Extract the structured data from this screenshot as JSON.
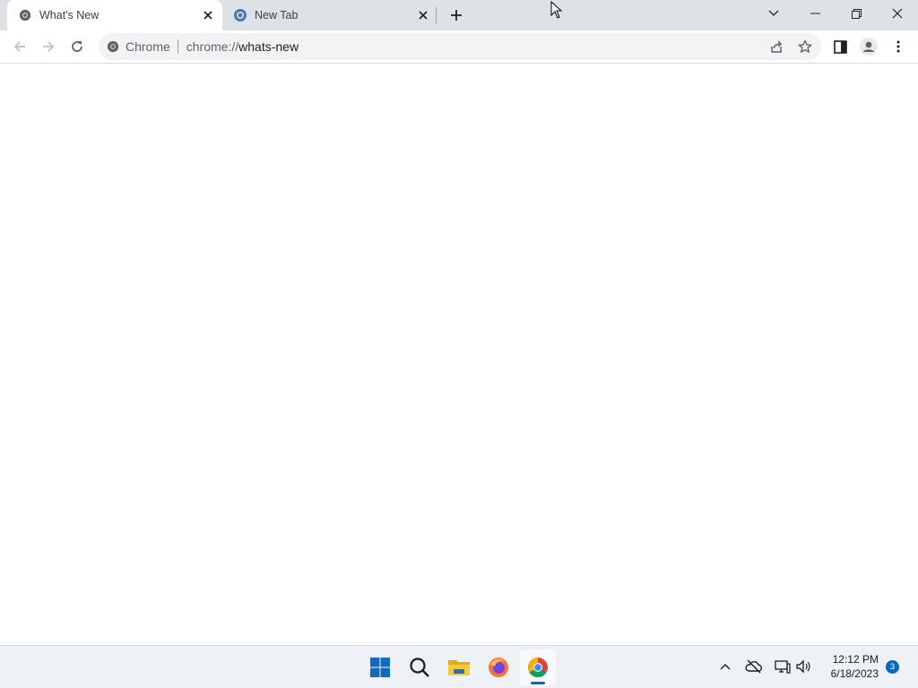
{
  "browser": {
    "tabs": [
      {
        "label": "What's New",
        "active": true,
        "icon": "chrome-icon"
      },
      {
        "label": "New Tab",
        "active": false,
        "icon": "chrome-newtab-icon"
      }
    ],
    "window_controls": [
      "tab-search-icon",
      "minimize-icon",
      "restore-icon",
      "close-icon"
    ]
  },
  "toolbar": {
    "omnibox": {
      "chip": "Chrome",
      "url_scheme": "chrome://",
      "url_host": "whats-new"
    },
    "buttons": [
      "back-icon",
      "forward-icon",
      "reload-icon",
      "share-icon",
      "bookmark-star-icon",
      "side-panel-icon",
      "profile-icon",
      "menu-icon"
    ]
  },
  "taskbar": {
    "apps": [
      "start-icon",
      "search-icon",
      "file-explorer-icon",
      "firefox-icon",
      "chrome-icon"
    ],
    "tray": [
      "show-hidden-icons-chevron",
      "onedrive-offline-icon",
      "network-icon",
      "volume-icon"
    ],
    "time": "12:12 PM",
    "date": "6/18/2023",
    "notification_count": "3"
  },
  "colors": {
    "tabstrip_bg": "#dee1e6",
    "omnibox_bg": "#f1f3f4",
    "taskbar_bg": "#eef1f5",
    "accent": "#0067c0"
  }
}
